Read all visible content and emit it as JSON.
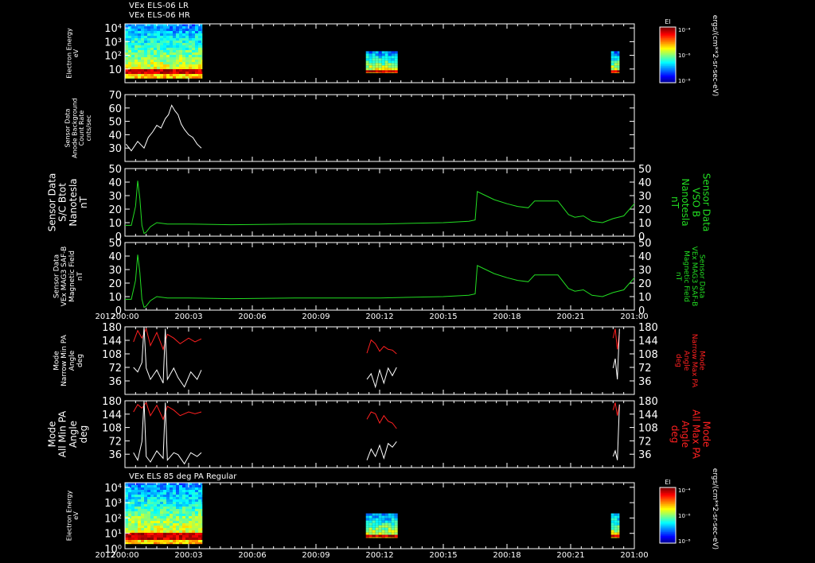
{
  "headers": {
    "line1": "VEx ELS-06 LR",
    "line2": "VEx ELS-06 HR",
    "bottom_title": "VEx ELS 85 deg PA Regular"
  },
  "year_label": "2012",
  "colors": {
    "background": "#000000",
    "axis": "#ffffff",
    "mag_trace": "#22dd22",
    "max_pa_trace": "#ff2020",
    "min_pa_trace": "#ffffff"
  },
  "colorbar": {
    "title": "El",
    "top_label": "10⁻⁴",
    "mid_label": "10⁻⁶",
    "bottom_label": "10⁻⁸",
    "units": "ergs/(cm**2-sr-sec-eV)"
  },
  "chart_data": [
    {
      "type": "heatmap",
      "id": "spec_top",
      "ylabel": [
        "Electron Energy",
        "eV"
      ],
      "yscale": "log",
      "ylim": [
        1,
        20000
      ],
      "yticks": [
        {
          "v": 10,
          "label": "10"
        },
        {
          "v": 100,
          "label": "10²"
        },
        {
          "v": 1000,
          "label": "10³"
        },
        {
          "v": 10000,
          "label": "10⁴"
        }
      ],
      "data_intervals": [
        {
          "t0": 0,
          "t1": 3.65,
          "emin": 2,
          "emax": 20000
        },
        {
          "t0": 11.35,
          "t1": 12.85,
          "emin": 5,
          "emax": 200
        },
        {
          "t0": 22.9,
          "t1": 23.3,
          "emin": 5,
          "emax": 200
        }
      ]
    },
    {
      "type": "line",
      "id": "background",
      "ylabel": [
        "Sensor Data",
        "Anode Background",
        "Count Rate",
        "cnts/sec"
      ],
      "ylim": [
        20,
        70
      ],
      "yticks": [
        30,
        40,
        50,
        60,
        70
      ],
      "series": [
        {
          "color": "white",
          "x": [
            0.05,
            0.3,
            0.6,
            0.9,
            1.1,
            1.3,
            1.5,
            1.7,
            1.9,
            2.05,
            2.2,
            2.35,
            2.5,
            2.65,
            2.8,
            3.0,
            3.2,
            3.4,
            3.6
          ],
          "y": [
            33,
            28,
            35,
            30,
            38,
            42,
            47,
            45,
            52,
            55,
            62,
            58,
            55,
            48,
            44,
            40,
            38,
            33,
            30
          ]
        }
      ]
    },
    {
      "type": "line",
      "id": "mag_vso",
      "ylabel": [
        "Sensor Data",
        "S/C Btot",
        "Nanotesla",
        "nT"
      ],
      "ylabel_right": [
        "Sensor Data",
        "VSO B",
        "Nanotesla",
        "nT"
      ],
      "ylim": [
        0,
        50
      ],
      "yticks": [
        0,
        10,
        20,
        30,
        40,
        50
      ],
      "series": [
        {
          "color": "green",
          "x": [
            0,
            0.3,
            0.5,
            0.6,
            0.7,
            0.8,
            0.9,
            1.0,
            1.2,
            1.5,
            2,
            3,
            5,
            8,
            10,
            12,
            15,
            16.2,
            16.5,
            16.6,
            17,
            17.4,
            18,
            18.5,
            19,
            19.3,
            19.6,
            20.4,
            20.9,
            21.2,
            21.6,
            22,
            22.5,
            23,
            23.5,
            24
          ],
          "y": [
            8,
            8,
            22,
            41,
            28,
            8,
            2,
            3,
            7,
            10,
            9,
            9,
            8.5,
            9,
            9,
            9,
            10,
            11,
            12,
            33,
            30,
            27,
            24,
            22,
            21,
            26,
            26,
            26,
            16,
            14,
            15,
            11,
            10,
            13,
            15,
            24
          ]
        }
      ]
    },
    {
      "type": "line",
      "id": "mag_saf",
      "ylabel": [
        "Sensor Data",
        "VEx MAG3 SAF-B",
        "Magnetic Field",
        "nT"
      ],
      "ylabel_right": [
        "Sensor Data",
        "VEx MAG3 SAF-B",
        "Magnetic Field",
        "nT"
      ],
      "ylim": [
        0,
        50
      ],
      "yticks": [
        0,
        10,
        20,
        30,
        40,
        50
      ],
      "xticks": [
        "200:00",
        "200:03",
        "200:06",
        "200:09",
        "200:12",
        "200:15",
        "200:18",
        "200:21",
        "201:00"
      ],
      "series": [
        {
          "color": "green",
          "x": [
            0,
            0.3,
            0.5,
            0.6,
            0.7,
            0.8,
            0.9,
            1.0,
            1.2,
            1.5,
            2,
            3,
            5,
            8,
            10,
            12,
            15,
            16.2,
            16.5,
            16.6,
            17,
            17.4,
            18,
            18.5,
            19,
            19.3,
            19.6,
            20.4,
            20.9,
            21.2,
            21.6,
            22,
            22.5,
            23,
            23.5,
            24
          ],
          "y": [
            8,
            8,
            22,
            41,
            28,
            8,
            2,
            3,
            7,
            10,
            9,
            9,
            8.5,
            9,
            9,
            9,
            10,
            11,
            12,
            33,
            30,
            27,
            24,
            22,
            21,
            26,
            26,
            26,
            16,
            14,
            15,
            11,
            10,
            13,
            15,
            24
          ]
        }
      ]
    },
    {
      "type": "line",
      "id": "narrow_pa",
      "ylabel": [
        "Mode",
        "Narrow Min PA",
        "Angle",
        "deg"
      ],
      "ylabel_right": [
        "Mode",
        "Narrow Max PA",
        "Angle",
        "deg"
      ],
      "ylim": [
        0,
        180
      ],
      "yticks": [
        36,
        72,
        108,
        144,
        180
      ],
      "series": [
        {
          "color": "red",
          "segments": [
            {
              "x": [
                0.4,
                0.6,
                0.8,
                1.0,
                1.2,
                1.5,
                1.8,
                2.0,
                2.3,
                2.6,
                3.0,
                3.3,
                3.6
              ],
              "y": [
                140,
                170,
                150,
                175,
                130,
                165,
                120,
                160,
                150,
                135,
                150,
                140,
                148
              ]
            },
            {
              "x": [
                11.4,
                11.6,
                11.8,
                12.0,
                12.2,
                12.4,
                12.6,
                12.8
              ],
              "y": [
                110,
                145,
                135,
                115,
                128,
                120,
                118,
                108
              ]
            },
            {
              "x": [
                23.0,
                23.1,
                23.2,
                23.3
              ],
              "y": [
                150,
                175,
                120,
                165
              ]
            }
          ]
        },
        {
          "color": "white",
          "segments": [
            {
              "x": [
                0.4,
                0.6,
                0.8,
                0.9,
                1.0,
                1.2,
                1.5,
                1.8,
                1.9,
                2.0,
                2.3,
                2.5,
                2.8,
                3.1,
                3.4,
                3.6
              ],
              "y": [
                72,
                60,
                85,
                180,
                70,
                40,
                65,
                30,
                175,
                40,
                70,
                45,
                20,
                60,
                40,
                65
              ]
            },
            {
              "x": [
                11.4,
                11.6,
                11.8,
                12.0,
                12.2,
                12.4,
                12.6,
                12.8
              ],
              "y": [
                40,
                55,
                20,
                65,
                30,
                70,
                50,
                72
              ]
            },
            {
              "x": [
                23.0,
                23.1,
                23.2,
                23.3
              ],
              "y": [
                70,
                95,
                40,
                175
              ]
            }
          ]
        }
      ]
    },
    {
      "type": "line",
      "id": "all_pa",
      "ylabel": [
        "Mode",
        "All Min PA",
        "Angle",
        "deg"
      ],
      "ylabel_right": [
        "Mode",
        "All Max PA",
        "Angle",
        "deg"
      ],
      "ylim": [
        0,
        180
      ],
      "yticks": [
        36,
        72,
        108,
        144,
        180
      ],
      "series": [
        {
          "color": "red",
          "segments": [
            {
              "x": [
                0.4,
                0.6,
                0.8,
                1.0,
                1.2,
                1.5,
                1.8,
                2.0,
                2.3,
                2.6,
                3.0,
                3.3,
                3.6
              ],
              "y": [
                150,
                170,
                160,
                175,
                140,
                168,
                130,
                165,
                155,
                140,
                150,
                145,
                150
              ]
            },
            {
              "x": [
                11.4,
                11.6,
                11.8,
                12.0,
                12.2,
                12.4,
                12.6,
                12.8
              ],
              "y": [
                130,
                150,
                145,
                120,
                140,
                125,
                120,
                105
              ]
            },
            {
              "x": [
                23.0,
                23.1,
                23.2,
                23.3
              ],
              "y": [
                155,
                175,
                140,
                170
              ]
            }
          ]
        },
        {
          "color": "white",
          "segments": [
            {
              "x": [
                0.4,
                0.6,
                0.8,
                0.9,
                1.0,
                1.2,
                1.5,
                1.8,
                1.9,
                2.0,
                2.3,
                2.5,
                2.8,
                3.1,
                3.4,
                3.6
              ],
              "y": [
                40,
                20,
                70,
                180,
                30,
                15,
                45,
                25,
                175,
                20,
                40,
                35,
                10,
                40,
                30,
                40
              ]
            },
            {
              "x": [
                11.4,
                11.6,
                11.8,
                12.0,
                12.2,
                12.4,
                12.6,
                12.8
              ],
              "y": [
                20,
                50,
                30,
                60,
                25,
                65,
                55,
                70
              ]
            },
            {
              "x": [
                23.0,
                23.1,
                23.2,
                23.3
              ],
              "y": [
                30,
                45,
                20,
                170
              ]
            }
          ]
        }
      ]
    },
    {
      "type": "heatmap",
      "id": "spec_bottom",
      "title": "VEx ELS 85 deg PA Regular",
      "ylabel": [
        "Electron Energy",
        "eV"
      ],
      "yscale": "log",
      "ylim": [
        1,
        20000
      ],
      "yticks": [
        {
          "v": 1,
          "label": "10⁰"
        },
        {
          "v": 10,
          "label": "10¹"
        },
        {
          "v": 100,
          "label": "10²"
        },
        {
          "v": 1000,
          "label": "10³"
        },
        {
          "v": 10000,
          "label": "10⁴"
        }
      ],
      "xticks": [
        "200:00",
        "200:03",
        "200:06",
        "200:09",
        "200:12",
        "200:15",
        "200:18",
        "200:21",
        "201:00"
      ],
      "data_intervals": [
        {
          "t0": 0,
          "t1": 3.65,
          "emin": 2,
          "emax": 20000
        },
        {
          "t0": 11.35,
          "t1": 12.85,
          "emin": 5,
          "emax": 200
        },
        {
          "t0": 22.9,
          "t1": 23.3,
          "emin": 5,
          "emax": 200
        }
      ]
    }
  ]
}
